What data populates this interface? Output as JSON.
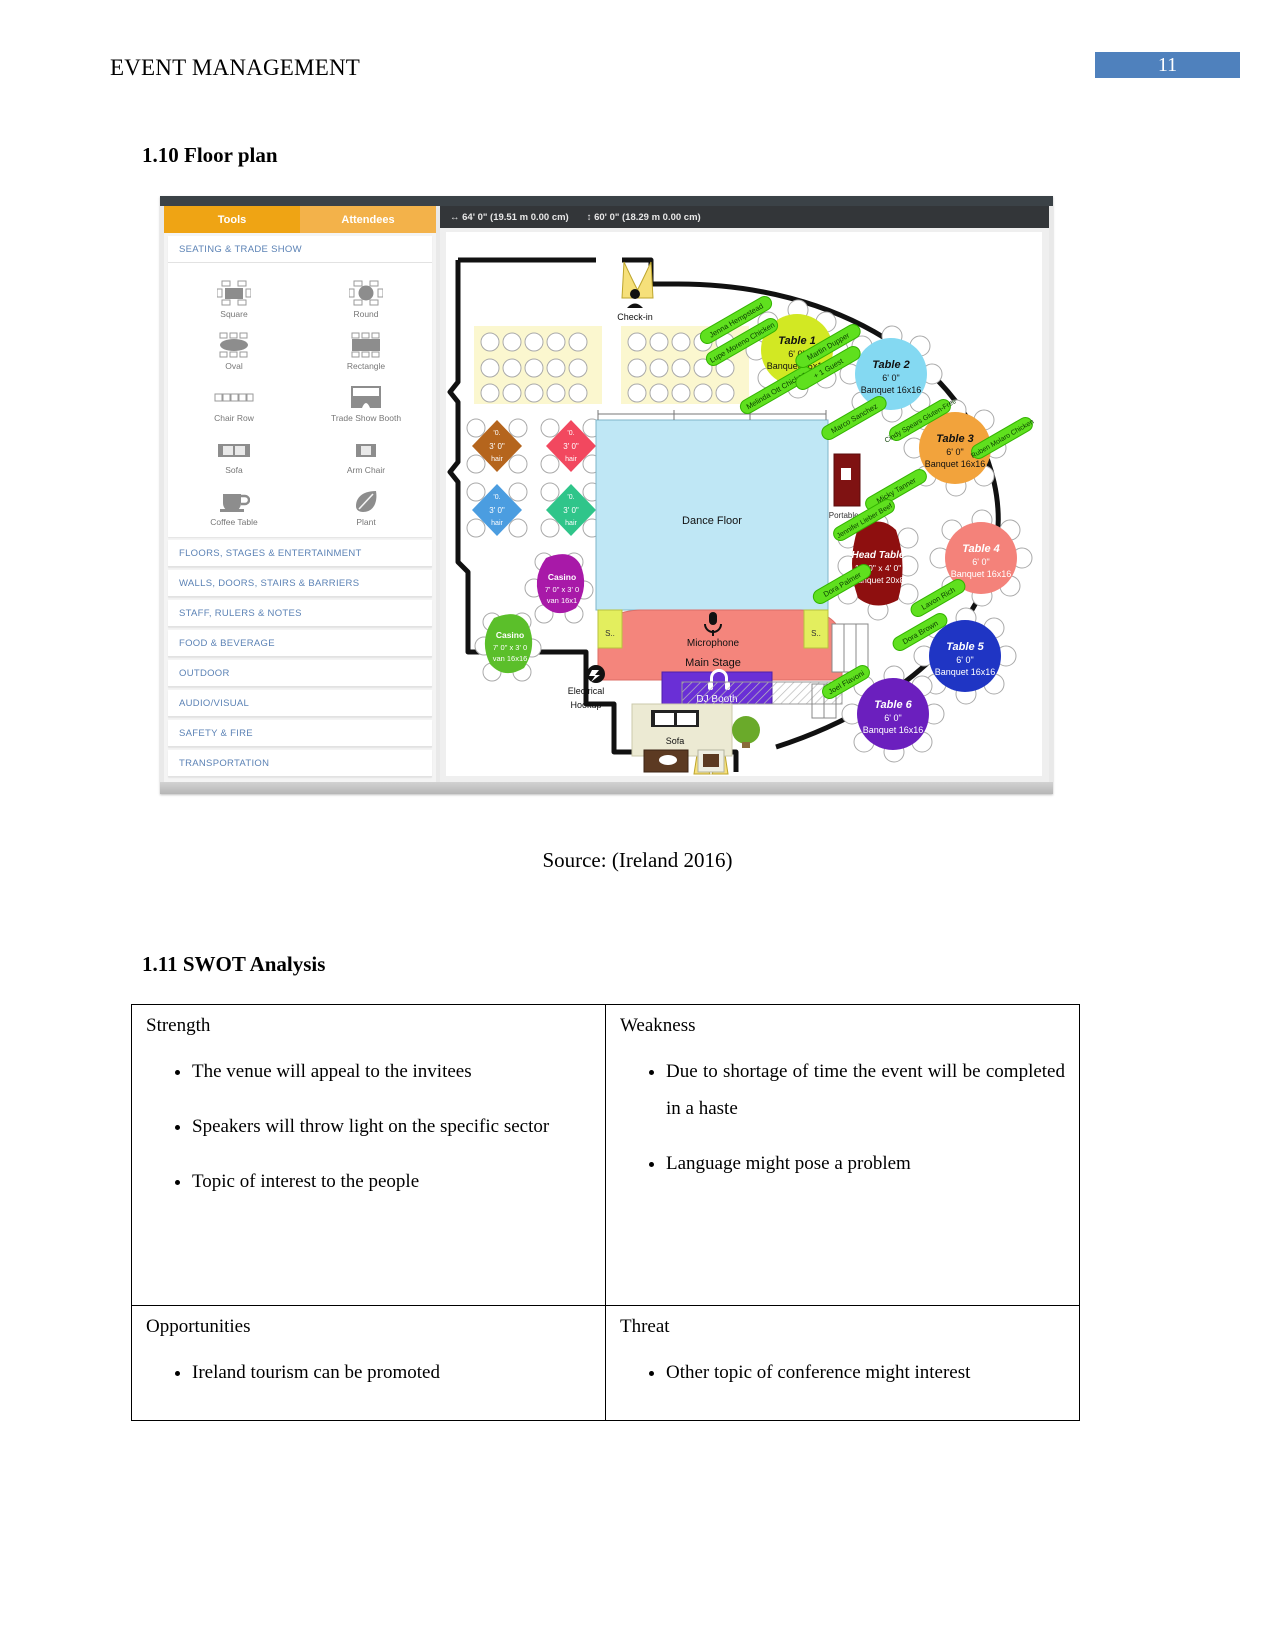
{
  "header": {
    "running_title": "EVENT MANAGEMENT",
    "page_number": "11"
  },
  "sections": {
    "floor_plan_heading": "1.10 Floor plan",
    "swot_heading": "1.11 SWOT Analysis",
    "figure_caption": "Source: (Ireland 2016)"
  },
  "floor_plan_app": {
    "tabs": [
      {
        "label": "Tools",
        "active": true
      },
      {
        "label": "Attendees",
        "active": false
      }
    ],
    "open_section": "SEATING & TRADE SHOW",
    "tools": [
      {
        "label": "Square",
        "icon": "square-table-icon"
      },
      {
        "label": "Round",
        "icon": "round-table-icon"
      },
      {
        "label": "Oval",
        "icon": "oval-table-icon"
      },
      {
        "label": "Rectangle",
        "icon": "rectangle-table-icon"
      },
      {
        "label": "Chair Row",
        "icon": "chair-row-icon"
      },
      {
        "label": "Trade Show Booth",
        "icon": "trade-show-booth-icon"
      },
      {
        "label": "Sofa",
        "icon": "sofa-icon"
      },
      {
        "label": "Arm Chair",
        "icon": "arm-chair-icon"
      },
      {
        "label": "Coffee Table",
        "icon": "coffee-table-icon"
      },
      {
        "label": "Plant",
        "icon": "plant-icon"
      }
    ],
    "collapsed_sections": [
      "FLOORS, STAGES & ENTERTAINMENT",
      "WALLS, DOORS, STAIRS & BARRIERS",
      "STAFF, RULERS & NOTES",
      "FOOD & BEVERAGE",
      "OUTDOOR",
      "AUDIO/VISUAL",
      "SAFETY & FIRE",
      "TRANSPORTATION"
    ],
    "canvas": {
      "width_dimension": "64' 0\" (19.51 m 0.00 cm)",
      "height_dimension": "60' 0\" (18.29 m 0.00 cm)",
      "labels": {
        "check_in": "Check-in",
        "dance_floor": "Dance Floor",
        "main_stage": "Main Stage",
        "microphone": "Microphone",
        "dj_booth": "DJ Booth",
        "electrical_hookup": "Electrical Hookup",
        "portable_bar": "Portable ..",
        "sofa": "Sofa",
        "table": "Table",
        "chair": "Cha.."
      },
      "tables": [
        {
          "name": "Table 1",
          "size": "6' 0\"",
          "setup": "Banquet 16x16",
          "color": "#d2e823",
          "guests": [
            "Jenna Hempstead",
            "Lupe Moreno Chicken",
            "Melinda Ott Chicken"
          ]
        },
        {
          "name": "Table 2",
          "size": "6' 0\"",
          "setup": "Banquet 16x16",
          "color": "#84d9f2",
          "guests": [
            "Martin Dupper",
            "+ 1 Guest",
            "Marco Sanchez"
          ]
        },
        {
          "name": "Table 3",
          "size": "6' 0\"",
          "setup": "Banquet 16x16",
          "color": "#f2a33c",
          "guests": [
            "Cindy Spears Gluten-Free",
            "Ruben Molaro Chicken",
            "Micky Tanner"
          ]
        },
        {
          "name": "Head Table",
          "size": "10' 0\" x 4' 0\"",
          "setup": "Banquet 20x8",
          "color": "#8e0f0f",
          "guests": [
            "Jennifer Lieber Beef",
            "Dora Palmer"
          ]
        },
        {
          "name": "Table 4",
          "size": "6' 0\"",
          "setup": "Banquet 16x16",
          "color": "#f4827a",
          "guests": [
            "Lavon Rich"
          ]
        },
        {
          "name": "Table 5",
          "size": "6' 0\"",
          "setup": "Banquet 16x16",
          "color": "#1f35c4",
          "guests": [
            "Dora Brown"
          ]
        },
        {
          "name": "Table 6",
          "size": "6' 0\"",
          "setup": "Banquet 16x16",
          "color": "#6b1fbe",
          "guests": [
            "Joel Flavoni"
          ]
        }
      ],
      "small_tables": [
        {
          "label": "3' 0\"",
          "color": "#b5651d"
        },
        {
          "label": "3' 0\"",
          "color": "#f2485f"
        },
        {
          "label": "3' 0\"",
          "color": "#4b9de0"
        },
        {
          "label": "3' 0\"",
          "color": "#2fc58a"
        }
      ],
      "casino_tables": [
        {
          "name": "Casino",
          "size": "7' 0\" x 3' 0\"",
          "setup": "Ovan 16x1",
          "color": "#a819a8"
        },
        {
          "name": "Casino",
          "size": "7' 0\" x 3' 0\"",
          "setup": "Ovan 16x16",
          "color": "#5bbf2a"
        }
      ]
    }
  },
  "swot": {
    "quadrants": [
      {
        "title": "Strength",
        "items": [
          "The venue will appeal to the invitees",
          "Speakers will throw light on the specific sector",
          "Topic of interest to the people"
        ]
      },
      {
        "title": "Weakness",
        "items": [
          "Due to shortage of time the event will be completed in a haste",
          "Language might pose a problem"
        ]
      },
      {
        "title": "Opportunities",
        "items": [
          "Ireland tourism can be promoted"
        ]
      },
      {
        "title": "Threat",
        "items": [
          "Other topic of conference might interest"
        ]
      }
    ]
  }
}
